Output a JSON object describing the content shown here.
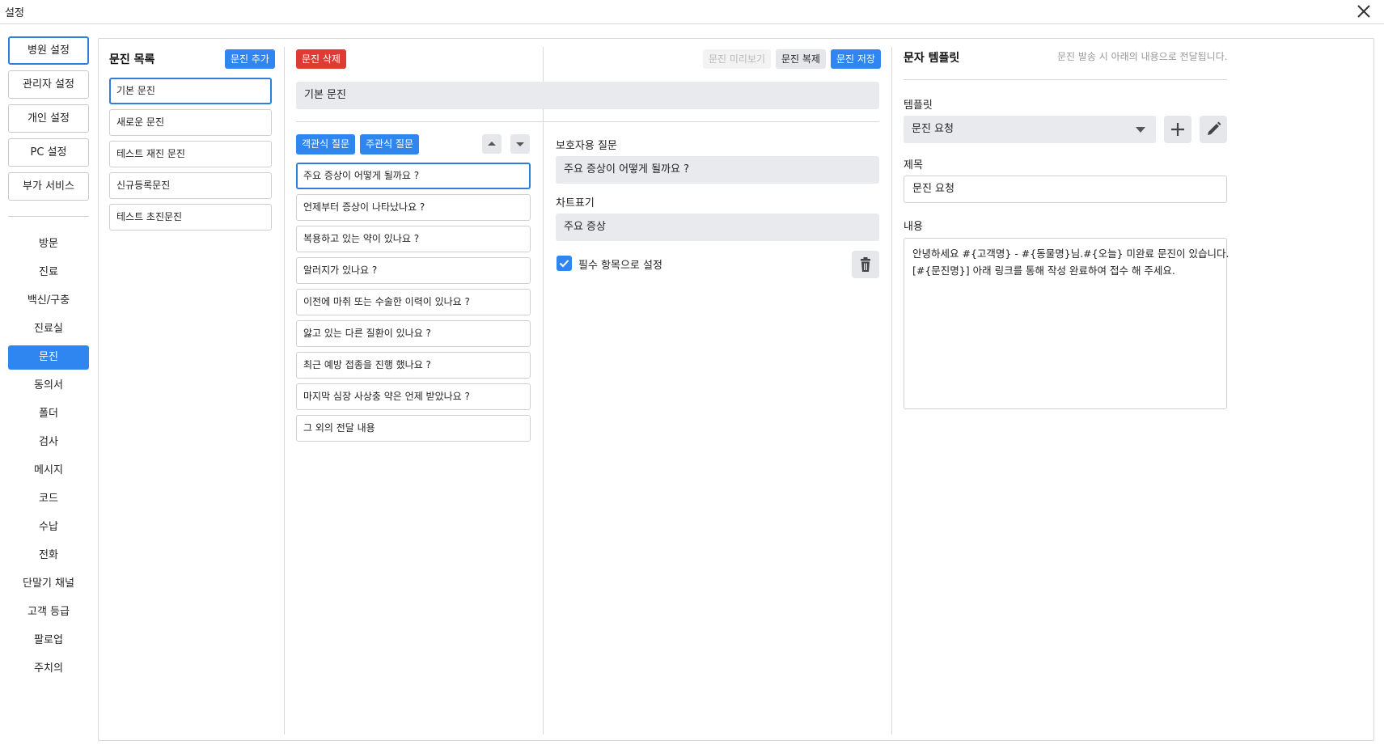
{
  "window": {
    "title": "설정"
  },
  "nav": {
    "top_buttons": [
      "병원 설정",
      "관리자 설정",
      "개인 설정",
      "PC 설정",
      "부가 서비스"
    ],
    "items": [
      "방문",
      "진료",
      "백신/구충",
      "진료실",
      "문진",
      "동의서",
      "폴더",
      "검사",
      "메시지",
      "코드",
      "수납",
      "전화",
      "단말기 채널",
      "고객 등급",
      "팔로업",
      "주치의"
    ]
  },
  "survey_list": {
    "title": "문진 목록",
    "add_label": "문진 추가",
    "items": [
      "기본 문진",
      "새로운 문진",
      "테스트 재진 문진",
      "신규등록문진",
      "테스트 초진문진"
    ]
  },
  "toolbar": {
    "delete_label": "문진 삭제",
    "preview_label": "문진 미리보기",
    "copy_label": "문진 복제",
    "save_label": "문진 저장"
  },
  "survey_name": "기본 문진",
  "questions": {
    "objective_label": "객관식 질문",
    "subjective_label": "주관식 질문",
    "items": [
      "주요 증상이 어떻게 될까요 ?",
      "언제부터 증상이 나타났나요 ?",
      "복용하고 있는 약이 있나요 ?",
      "알러지가 있나요 ?",
      "이전에 마취 또는 수술한 이력이 있나요 ?",
      "앓고 있는 다른 질환이 있나요 ?",
      "최근 예방 접종을 진행 했나요 ?",
      "마지막 심장 사상충 약은 언제 받았나요 ?",
      "그 외의 전달 내용"
    ]
  },
  "detail": {
    "guardian_question_label": "보호자용 질문",
    "guardian_question_value": "주요 증상이 어떻게 될까요 ?",
    "chart_label": "차트표기",
    "chart_value": "주요 증상",
    "required_label": "필수 항목으로 설정",
    "required_checked": true
  },
  "sms": {
    "title": "문자 템플릿",
    "hint": "문진 발송 시 아래의 내용으로 전달됩니다.",
    "template_label": "템플릿",
    "template_value": "문진 요청",
    "subject_label": "제목",
    "subject_value": "문진 요청",
    "content_label": "내용",
    "content_line1": "안녕하세요 #{고객명} - #{동물명}님.#{오늘} 미완료 문진이 있습니다.",
    "content_line2": "[#{문진명}] 아래 링크를 통해 작성 완료하여 접수 해 주세요."
  },
  "colors": {
    "accent": "#2f86f0",
    "danger": "#e03a35",
    "field_bg": "#e9eaee"
  },
  "icons": [
    "close-icon",
    "arrow-up-icon",
    "arrow-down-icon",
    "check-icon",
    "trash-icon",
    "dropdown-caret-icon",
    "plus-icon",
    "pencil-icon"
  ]
}
